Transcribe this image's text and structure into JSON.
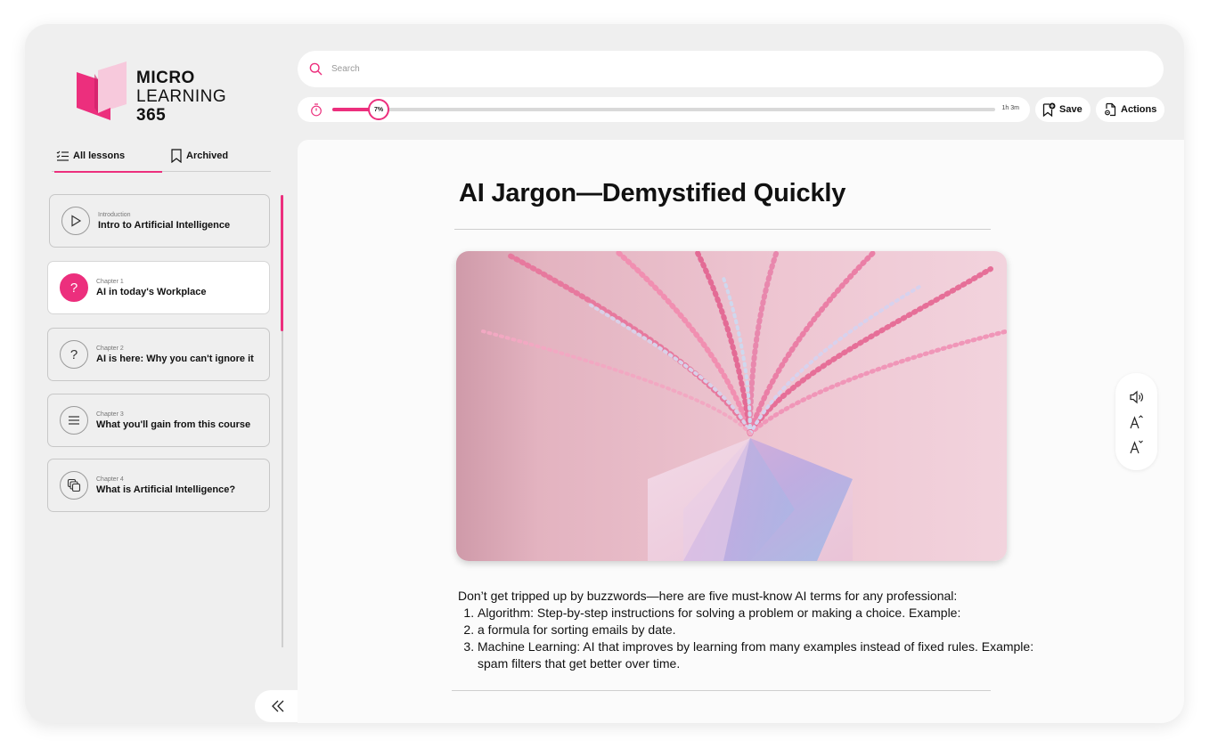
{
  "brand": {
    "line1": "MICRO",
    "line2": "LEARNING",
    "line3": "365",
    "accent": "#ec2f7d",
    "accent_light": "#f7c9dc"
  },
  "search": {
    "placeholder": "Search",
    "icon": "search-icon"
  },
  "progress": {
    "percent_label": "7%",
    "percent": 7,
    "duration": "1h 3m",
    "icon": "timer-icon"
  },
  "toolbar": {
    "save_label": "Save",
    "actions_label": "Actions"
  },
  "sidebar": {
    "tabs": [
      {
        "label": "All lessons",
        "icon": "list-icon",
        "active": true
      },
      {
        "label": "Archived",
        "icon": "bookmark-icon",
        "active": false
      }
    ],
    "lessons": [
      {
        "kicker": "Introduction",
        "title": "Intro to Artificial Intelligence",
        "icon": "play-icon",
        "active": false
      },
      {
        "kicker": "Chapter 1",
        "title": "AI in today's Workplace",
        "icon": "question-icon",
        "active": true
      },
      {
        "kicker": "Chapter 2",
        "title": "AI is here: Why you can't ignore it",
        "icon": "question-icon",
        "active": false
      },
      {
        "kicker": "Chapter 3",
        "title": "What you'll gain from this course",
        "icon": "menu-icon",
        "active": false
      },
      {
        "kicker": "Chapter 4",
        "title": "What is Artificial Intelligence?",
        "icon": "layers-icon",
        "active": false
      }
    ]
  },
  "article": {
    "title": "AI Jargon—Demystified Quickly",
    "intro": "Don’t get tripped up by buzzwords—here are five must-know AI terms for any professional:",
    "items": [
      "Algorithm: Step-by-step instructions for solving a problem or making a choice. Example:",
      "a formula for sorting emails by date.",
      "Machine Learning: AI that improves by learning from many examples instead of fixed rules. Example: spam filters that get better over time."
    ]
  },
  "tools": [
    "speaker-icon",
    "font-increase-icon",
    "font-decrease-icon"
  ]
}
